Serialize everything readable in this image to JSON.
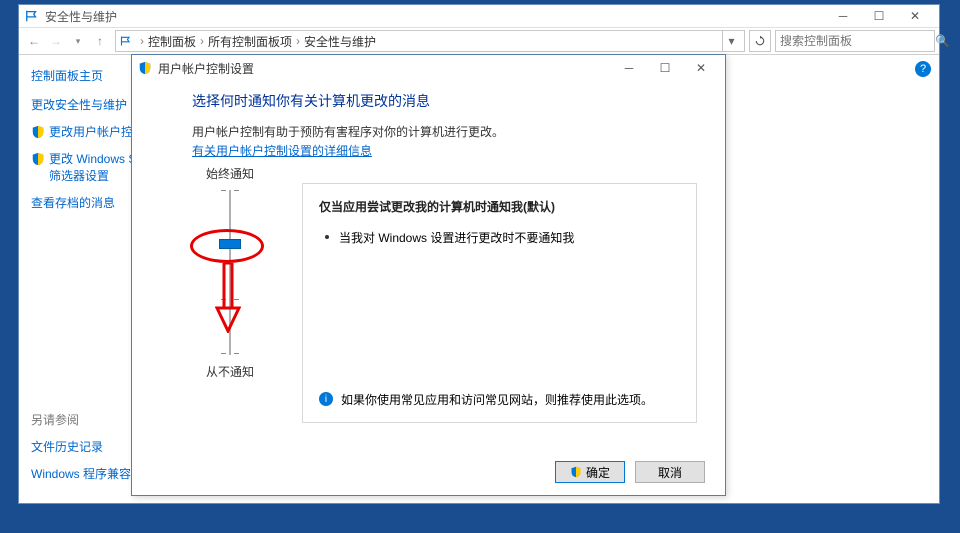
{
  "outer_window": {
    "title": "安全性与维护",
    "breadcrumb": [
      "控制面板",
      "所有控制面板项",
      "安全性与维护"
    ],
    "search_placeholder": "搜索控制面板"
  },
  "sidebar": {
    "title": "控制面板主页",
    "items": [
      {
        "label": "更改安全性与维护",
        "shield": false
      },
      {
        "label": "更改用户帐户控制",
        "shield": true
      },
      {
        "label": "更改 Windows Sm",
        "label2": "筛选器设置",
        "shield": true
      },
      {
        "label": "查看存档的消息",
        "shield": false
      }
    ],
    "see_also": "另请参阅",
    "see_also_items": [
      "文件历史记录",
      "Windows 程序兼容"
    ]
  },
  "dialog": {
    "title": "用户帐户控制设置",
    "heading": "选择何时通知你有关计算机更改的消息",
    "desc": "用户帐户控制有助于预防有害程序对你的计算机进行更改。",
    "link": "有关用户帐户控制设置的详细信息",
    "slider": {
      "top_label": "始终通知",
      "bottom_label": "从不通知",
      "levels": 4,
      "current_level": 1
    },
    "info": {
      "title": "仅当应用尝试更改我的计算机时通知我(默认)",
      "bullet": "当我对 Windows 设置进行更改时不要通知我",
      "note": "如果你使用常见应用和访问常见网站，则推荐使用此选项。"
    },
    "buttons": {
      "ok": "确定",
      "cancel": "取消"
    }
  }
}
